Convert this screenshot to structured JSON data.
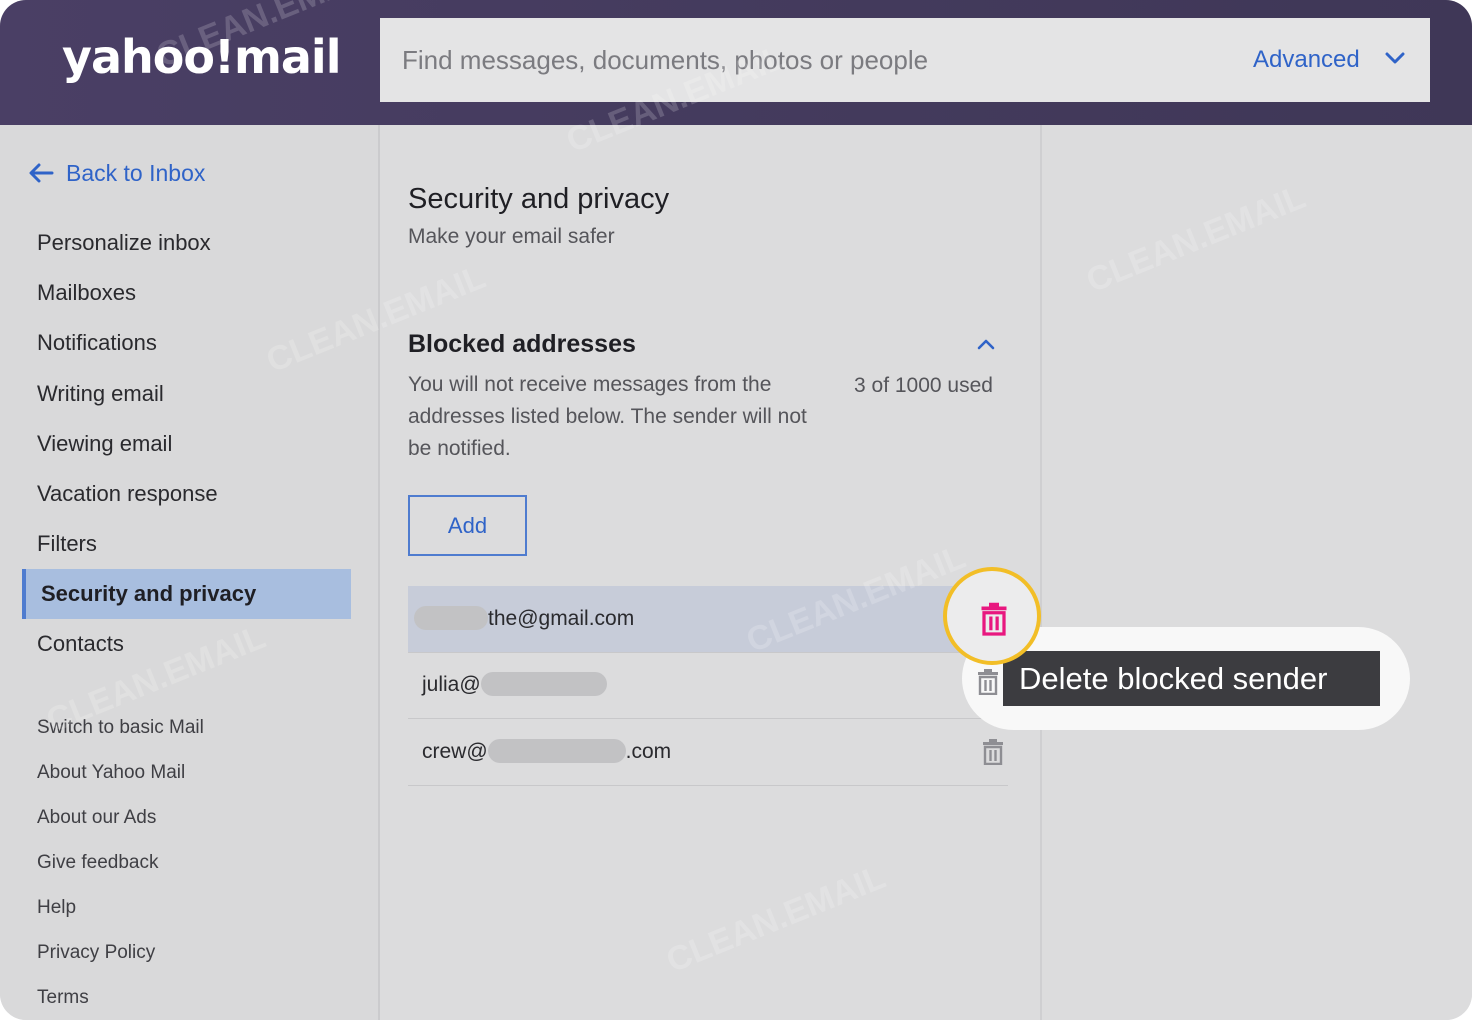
{
  "header": {
    "logo": "yahoo!mail",
    "search_placeholder": "Find messages, documents, photos or people",
    "advanced_label": "Advanced"
  },
  "sidebar": {
    "back_label": "Back to Inbox",
    "items": [
      {
        "label": "Personalize inbox",
        "active": false
      },
      {
        "label": "Mailboxes",
        "active": false
      },
      {
        "label": "Notifications",
        "active": false
      },
      {
        "label": "Writing email",
        "active": false
      },
      {
        "label": "Viewing email",
        "active": false
      },
      {
        "label": "Vacation response",
        "active": false
      },
      {
        "label": "Filters",
        "active": false
      },
      {
        "label": "Security and privacy",
        "active": true
      },
      {
        "label": "Contacts",
        "active": false
      }
    ],
    "links": [
      "Switch to basic Mail",
      "About Yahoo Mail",
      "About our Ads",
      "Give feedback",
      "Help",
      "Privacy Policy",
      "Terms"
    ]
  },
  "content": {
    "title": "Security and privacy",
    "subtitle": "Make your email safer",
    "section_title": "Blocked addresses",
    "description": "You will not receive messages from the addresses listed below. The sender will not be notified.",
    "usage": "3 of 1000 used",
    "add_label": "Add",
    "blocked": [
      {
        "prefix": "",
        "suffix": "the@gmail.com"
      },
      {
        "prefix": "julia@",
        "suffix": ""
      },
      {
        "prefix": "crew@",
        "suffix": ".com"
      }
    ]
  },
  "tooltip": "Delete blocked sender",
  "watermark": "CLEAN.EMAIL",
  "colors": {
    "header": "#4a3f65",
    "link_blue": "#2f63c8",
    "active_item": "#a8bedf",
    "trash_active": "#e8177f",
    "highlight_ring": "#f2be27"
  }
}
